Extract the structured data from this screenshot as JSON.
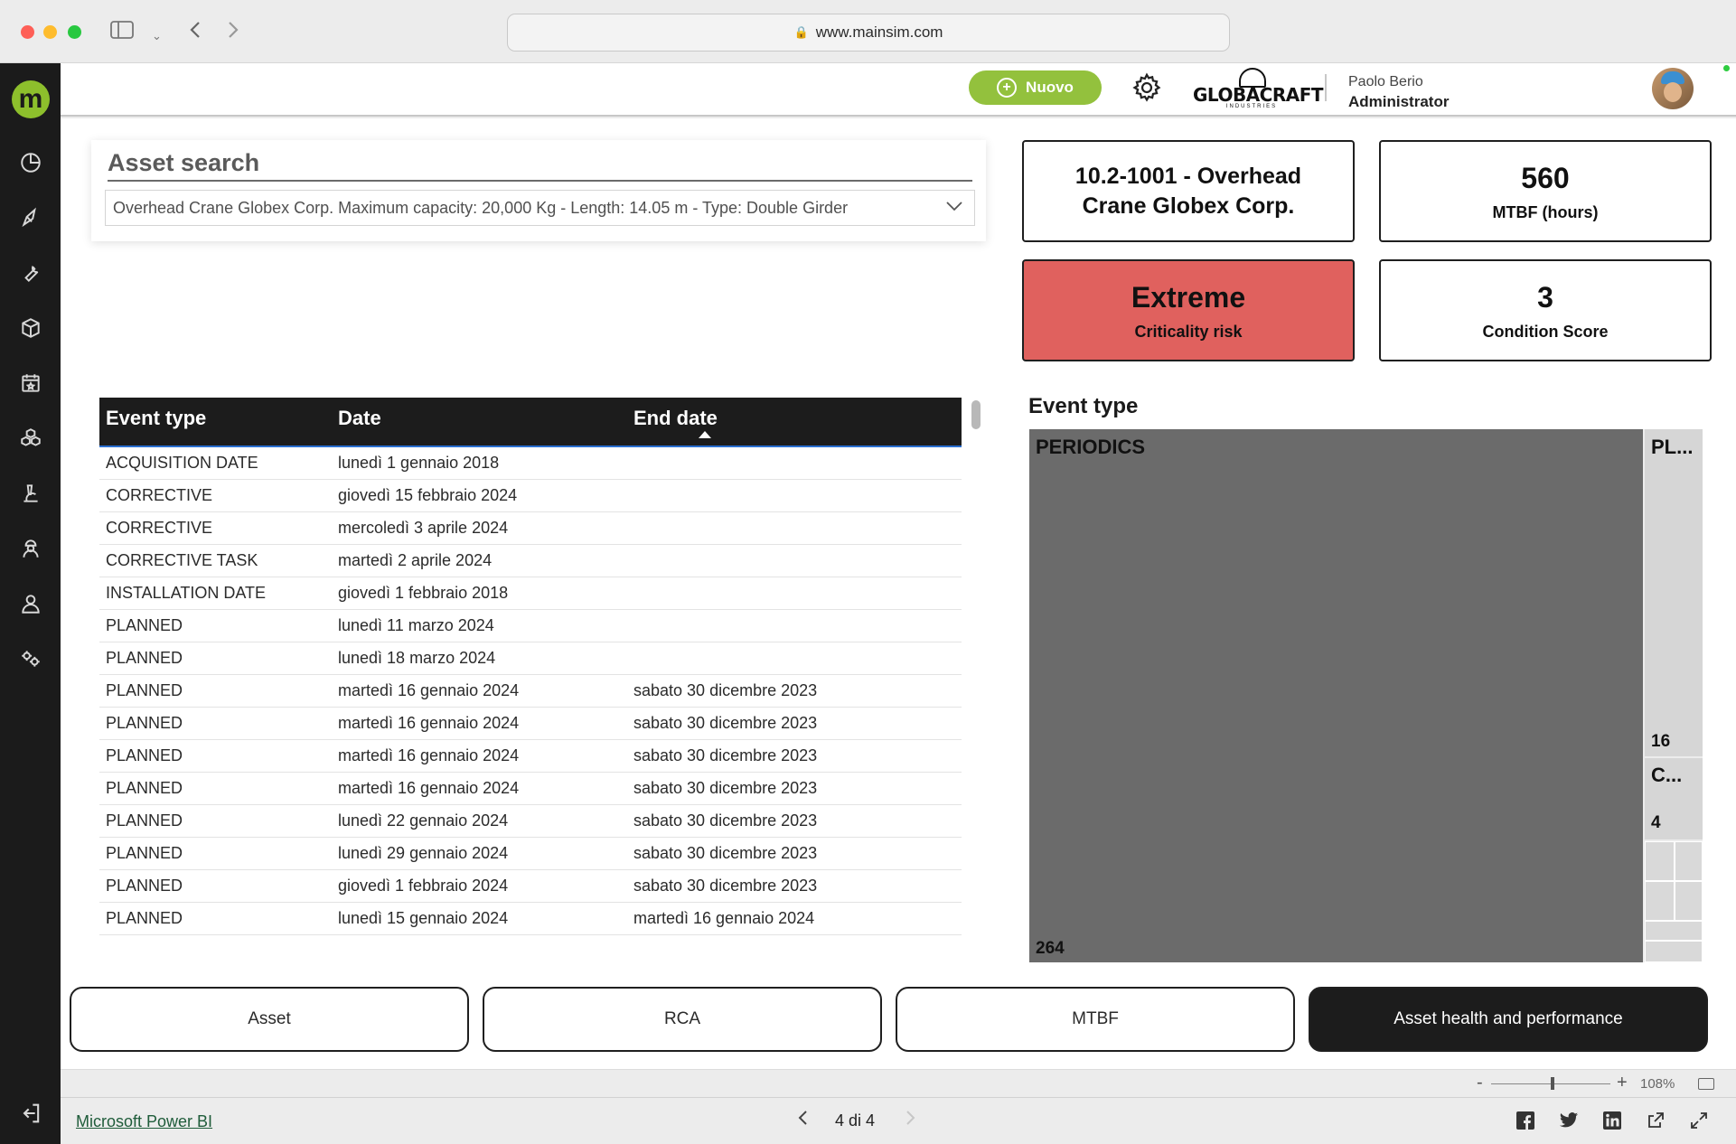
{
  "browser": {
    "url": "www.mainsim.com"
  },
  "header": {
    "new_button": "Nuovo",
    "company_name": "GLOBACRAFT",
    "company_sub": "INDUSTRIES",
    "user_name": "Paolo Berio",
    "user_role": "Administrator"
  },
  "sidebar": {
    "logo_letter": "m",
    "icons": [
      "dashboard-icon",
      "rocket-icon",
      "wrench-icon",
      "box-icon",
      "calendar-icon",
      "cubes-icon",
      "microscope-icon",
      "worker-icon",
      "user-icon",
      "settings-icon",
      "logout-icon"
    ]
  },
  "asset_search": {
    "label": "Asset search",
    "selected": "Overhead Crane Globex Corp. Maximum capacity: 20,000 Kg - Length: 14.05 m - Type: Double Girder"
  },
  "cards": {
    "asset_title": "10.2-1001 - Overhead Crane Globex Corp.",
    "mtbf_value": "560",
    "mtbf_label": "MTBF (hours)",
    "risk_value": "Extreme",
    "risk_label": "Criticality risk",
    "condition_value": "3",
    "condition_label": "Condition Score",
    "risk_color": "#e0615e"
  },
  "table": {
    "columns": [
      "Event type",
      "Date",
      "End date"
    ],
    "rows": [
      [
        "ACQUISITION DATE",
        "lunedì 1 gennaio 2018",
        ""
      ],
      [
        "CORRECTIVE",
        "giovedì 15 febbraio 2024",
        ""
      ],
      [
        "CORRECTIVE",
        "mercoledì 3 aprile 2024",
        ""
      ],
      [
        "CORRECTIVE TASK",
        "martedì 2 aprile 2024",
        ""
      ],
      [
        "INSTALLATION DATE",
        "giovedì 1 febbraio 2018",
        ""
      ],
      [
        "PLANNED",
        "lunedì 11 marzo 2024",
        ""
      ],
      [
        "PLANNED",
        "lunedì 18 marzo 2024",
        ""
      ],
      [
        "PLANNED",
        "martedì 16 gennaio 2024",
        "sabato 30 dicembre 2023"
      ],
      [
        "PLANNED",
        "martedì 16 gennaio 2024",
        "sabato 30 dicembre 2023"
      ],
      [
        "PLANNED",
        "martedì 16 gennaio 2024",
        "sabato 30 dicembre 2023"
      ],
      [
        "PLANNED",
        "martedì 16 gennaio 2024",
        "sabato 30 dicembre 2023"
      ],
      [
        "PLANNED",
        "lunedì 22 gennaio 2024",
        "sabato 30 dicembre 2023"
      ],
      [
        "PLANNED",
        "lunedì 29 gennaio 2024",
        "sabato 30 dicembre 2023"
      ],
      [
        "PLANNED",
        "giovedì 1 febbraio 2024",
        "sabato 30 dicembre 2023"
      ],
      [
        "PLANNED",
        "lunedì 15 gennaio 2024",
        "martedì 16 gennaio 2024"
      ]
    ]
  },
  "treemap": {
    "title": "Event type",
    "items": [
      {
        "label": "PERIODICS",
        "value": "264"
      },
      {
        "label": "PL...",
        "value": "16"
      },
      {
        "label": "C...",
        "value": "4"
      }
    ]
  },
  "nav_buttons": [
    "Asset",
    "RCA",
    "MTBF",
    "Asset health and performance"
  ],
  "footer": {
    "zoom": "108%",
    "zoom_minus": "-",
    "zoom_plus": "+",
    "powerbi_link": "Microsoft Power BI",
    "page_indicator": "4 di 4",
    "share": [
      "facebook-icon",
      "twitter-icon",
      "linkedin-icon",
      "share-icon",
      "expand-icon"
    ]
  }
}
